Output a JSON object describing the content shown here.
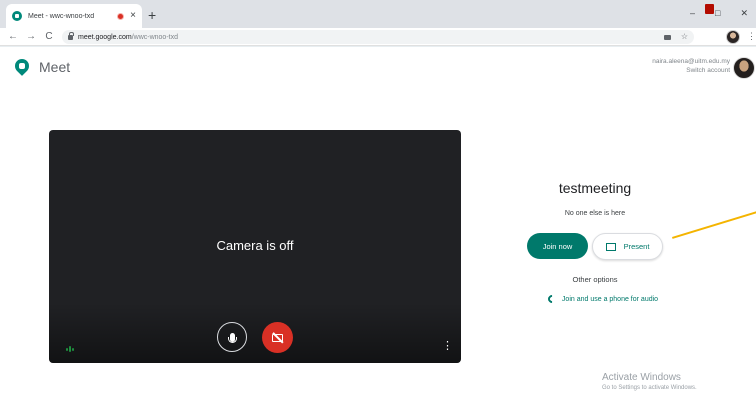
{
  "browser": {
    "tab_title": "Meet - wwc-wnoo-txd",
    "tab_close": "×",
    "new_tab": "+",
    "window_controls": [
      "–",
      "□",
      "✕"
    ],
    "nav": {
      "back": "←",
      "forward": "→",
      "reload": "C"
    },
    "url_host": "meet.google.com",
    "url_path": "/wwc-wnoo-txd",
    "star": "☆",
    "more": "⋮"
  },
  "header": {
    "logo_text": "Meet",
    "account_email": "naira.aleena@uitm.edu.my",
    "switch_account": "Switch account"
  },
  "preview": {
    "camera_status": "Camera is off",
    "more_icon": "⋮"
  },
  "join": {
    "meeting_code": "testmeeting",
    "participants_status": "No one else is here",
    "join_label": "Join now",
    "present_label": "Present",
    "other_options_label": "Other options",
    "phone_label": "Join and use a phone for audio"
  },
  "watermark": {
    "title": "Activate Windows",
    "subtitle": "Go to Settings to activate Windows."
  },
  "colors": {
    "accent": "#00796b",
    "danger": "#d93025",
    "annotation": "#f4b400"
  }
}
